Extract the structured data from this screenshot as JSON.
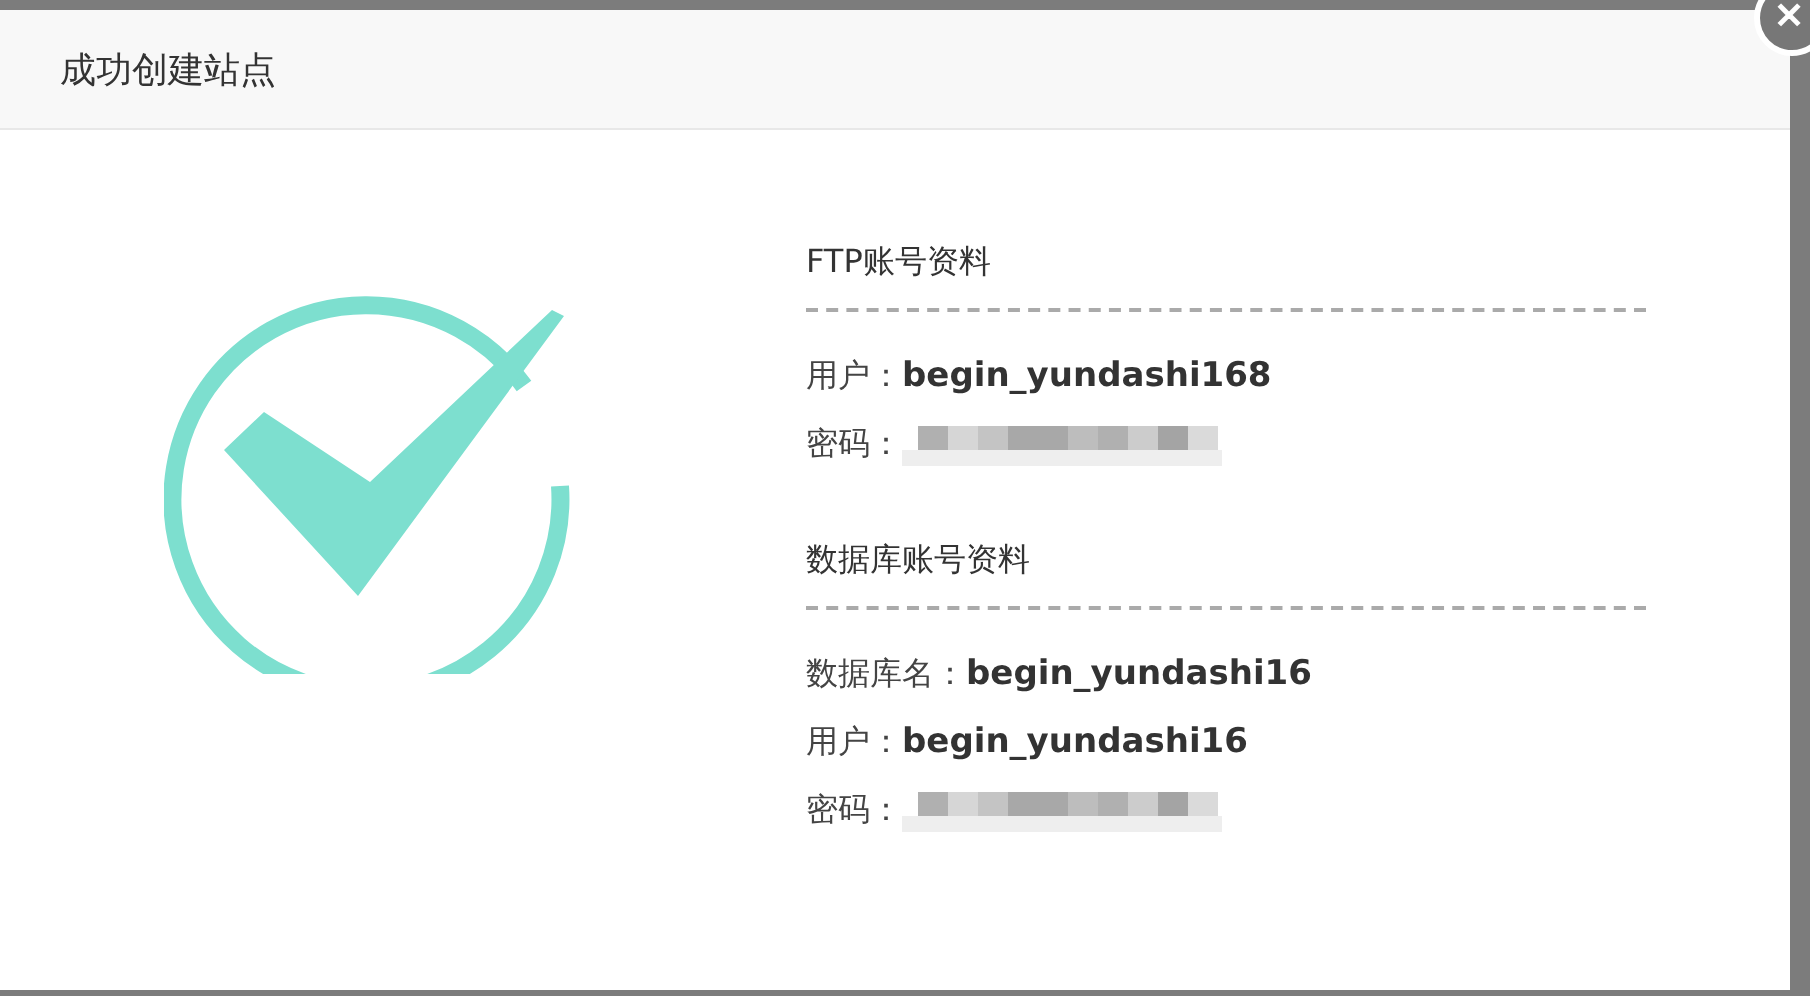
{
  "dialog": {
    "title": "成功创建站点",
    "close_label": "✕"
  },
  "sections": [
    {
      "title": "FTP账号资料",
      "rows": [
        {
          "kind": "text",
          "label": "用户：",
          "value": "begin_yundashi168"
        },
        {
          "kind": "redacted",
          "label": "密码："
        }
      ]
    },
    {
      "title": "数据库账号资料",
      "rows": [
        {
          "kind": "text",
          "label": "数据库名：",
          "value": "begin_yundashi16"
        },
        {
          "kind": "text",
          "label": "用户：",
          "value": "begin_yundashi16"
        },
        {
          "kind": "redacted",
          "label": "密码："
        }
      ]
    }
  ]
}
